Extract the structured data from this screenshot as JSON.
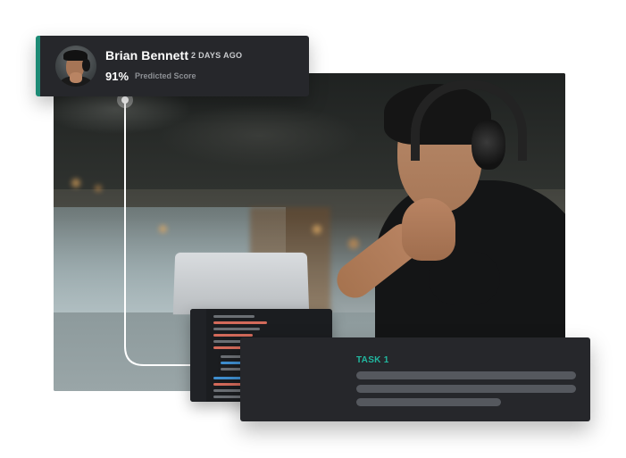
{
  "profile": {
    "name": "Brian Bennett",
    "time_ago": "2 DAYS AGO",
    "score": "91%",
    "score_label": "Predicted Score"
  },
  "task": {
    "label": "TASK 1",
    "placeholder_lines": 3
  },
  "colors": {
    "accent": "#1d8a75",
    "task_accent": "#21b8a0",
    "card_bg": "#26272b"
  },
  "icons": {
    "play": "play-icon",
    "avatar": "avatar"
  }
}
